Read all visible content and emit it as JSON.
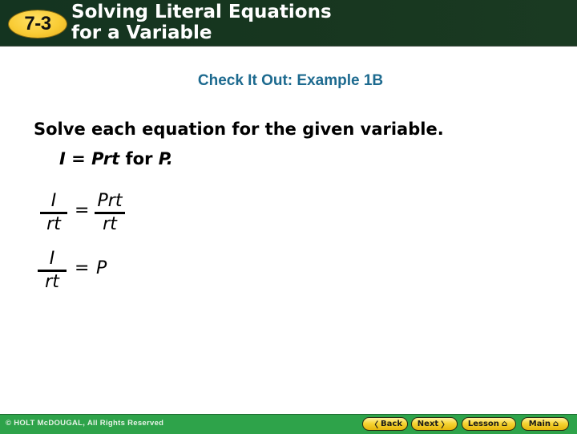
{
  "header": {
    "lesson_number": "7-3",
    "title_line1": "Solving Literal Equations",
    "title_line2": "for a Variable",
    "background_color": "#17361f",
    "badge_color": "#f9cc35"
  },
  "content": {
    "subtitle": "Check It Out: Example 1B",
    "instruction": "Solve each equation for the given variable.",
    "problem": {
      "equation_left": "I",
      "equals": "=",
      "equation_right": "Prt",
      "connector": "for",
      "variable": "P."
    },
    "steps": [
      {
        "lhs_numerator": "I",
        "lhs_denominator": "rt",
        "equals": "=",
        "rhs_numerator": "Prt",
        "rhs_denominator": "rt"
      },
      {
        "lhs_numerator": "I",
        "lhs_denominator": "rt",
        "equals": "=",
        "rhs": "P"
      }
    ],
    "subtitle_color": "#1d6a8f"
  },
  "footer": {
    "copyright": "© HOLT McDOUGAL, All Rights Reserved",
    "background_color": "#2ea34a",
    "buttons": [
      {
        "label": "Back",
        "icon": "chevron-left-icon",
        "glyph": "〈"
      },
      {
        "label": "Next",
        "icon": "chevron-right-icon",
        "glyph": "〉"
      },
      {
        "label": "Lesson",
        "icon": "home-icon",
        "glyph": "⌂"
      },
      {
        "label": "Main",
        "icon": "home-icon",
        "glyph": "⌂"
      }
    ]
  }
}
